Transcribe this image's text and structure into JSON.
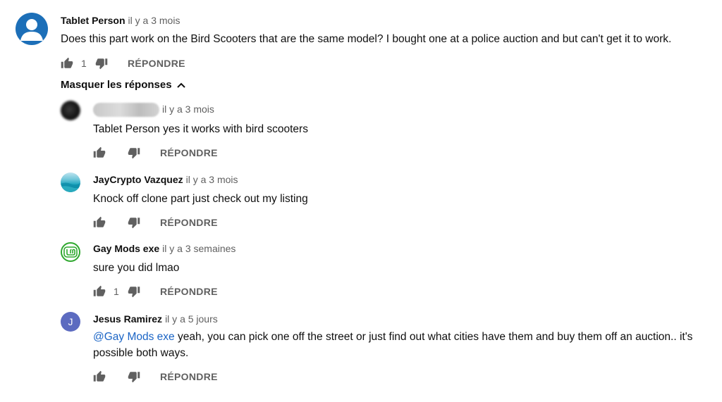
{
  "top_comment": {
    "author": "Tablet Person",
    "time": "il y a 3 mois",
    "text": "Does this part work on the Bird Scooters that are the same model? I bought one at a police auction and but can't get it to work.",
    "likes": "1",
    "reply_label": "RÉPONDRE",
    "avatar_color": "#1c6fb8"
  },
  "toggle": {
    "label": "Masquer les réponses"
  },
  "replies": [
    {
      "author": "",
      "time": "il y a 3 mois",
      "text": "Tablet Person yes it works with bird scooters",
      "likes": "",
      "reply_label": "RÉPONDRE"
    },
    {
      "author": "JayCrypto Vazquez",
      "time": "il y a 3 mois",
      "text": "Knock off clone part  just check out my listing",
      "likes": "",
      "reply_label": "RÉPONDRE"
    },
    {
      "author": "Gay Mods exe",
      "time": "il y a 3 semaines",
      "text": "sure you did lmao",
      "likes": "1",
      "reply_label": "RÉPONDRE"
    },
    {
      "author": "Jesus Ramirez",
      "time": "il y a 5 jours",
      "avatar_letter": "J",
      "avatar_color": "#5c6bc0",
      "mention": "@Gay Mods exe",
      "text": " yeah, you can pick one off the street or just find out what cities have them and buy them off an auction..  it's possible both ways.",
      "likes": "",
      "reply_label": "RÉPONDRE"
    }
  ],
  "icons": {
    "like": "thumbs-up-icon",
    "dislike": "thumbs-down-icon",
    "toggle": "chevron-up-icon"
  }
}
